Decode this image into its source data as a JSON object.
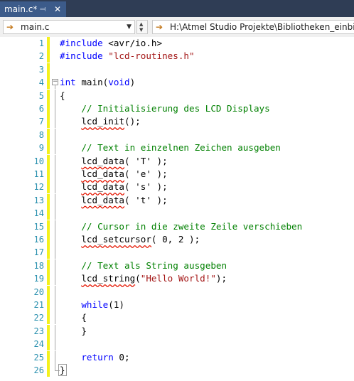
{
  "tab": {
    "title": "main.c*",
    "pin_icon": "pin-icon",
    "close_icon": "close-icon"
  },
  "nav": {
    "file_dropdown": "main.c",
    "path_dropdown": "H:\\Atmel Studio Projekte\\Bibliotheken_einbinden"
  },
  "editor": {
    "lines": [
      {
        "n": "1",
        "text": "#include <avr/io.h>"
      },
      {
        "n": "2",
        "text": "#include \"lcd-routines.h\""
      },
      {
        "n": "3",
        "text": ""
      },
      {
        "n": "4",
        "text": "int main(void)"
      },
      {
        "n": "5",
        "text": "{"
      },
      {
        "n": "6",
        "text": "    // Initialisierung des LCD Displays"
      },
      {
        "n": "7",
        "text": "    lcd_init();"
      },
      {
        "n": "8",
        "text": ""
      },
      {
        "n": "9",
        "text": "    // Text in einzelnen Zeichen ausgeben"
      },
      {
        "n": "10",
        "text": "    lcd_data( 'T' );"
      },
      {
        "n": "11",
        "text": "    lcd_data( 'e' );"
      },
      {
        "n": "12",
        "text": "    lcd_data( 's' );"
      },
      {
        "n": "13",
        "text": "    lcd_data( 't' );"
      },
      {
        "n": "14",
        "text": ""
      },
      {
        "n": "15",
        "text": "    // Cursor in die zweite Zeile verschieben"
      },
      {
        "n": "16",
        "text": "    lcd_setcursor( 0, 2 );"
      },
      {
        "n": "17",
        "text": ""
      },
      {
        "n": "18",
        "text": "    // Text als String ausgeben"
      },
      {
        "n": "19",
        "text": "    lcd_string(\"Hello World!\");"
      },
      {
        "n": "20",
        "text": ""
      },
      {
        "n": "21",
        "text": "    while(1)"
      },
      {
        "n": "22",
        "text": "    {"
      },
      {
        "n": "23",
        "text": "    }"
      },
      {
        "n": "24",
        "text": ""
      },
      {
        "n": "25",
        "text": "    return 0;"
      },
      {
        "n": "26",
        "text": "}"
      }
    ]
  },
  "colors": {
    "keyword": "#0000ff",
    "string": "#a31515",
    "comment": "#008000",
    "line_number": "#2b91af",
    "change_marker": "#f4f11c",
    "tab_active": "#3c5b8a"
  }
}
